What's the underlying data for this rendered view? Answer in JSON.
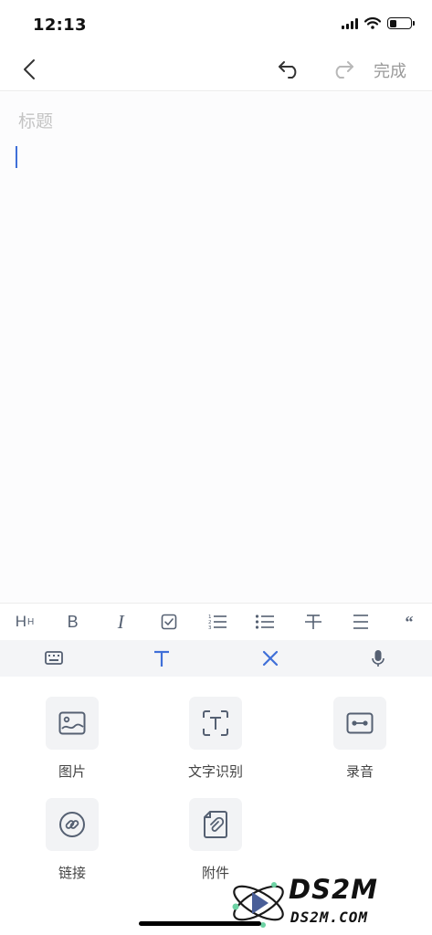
{
  "status_bar": {
    "time": "12:13",
    "battery_level": 0.35
  },
  "nav": {
    "back_icon": "chevron-left-icon",
    "undo_icon": "undo-icon",
    "redo_icon": "redo-icon",
    "done_label": "完成"
  },
  "editor": {
    "title_placeholder": "标题"
  },
  "format_bar": {
    "heading_label": "H",
    "heading_sub": "H",
    "bold_label": "B",
    "italic_label": "I",
    "checkbox_icon": "checkbox-icon",
    "ordered_list_icon": "ordered-list-icon",
    "bullet_list_icon": "bullet-list-icon",
    "strikethrough_icon": "strikethrough-icon",
    "align_icon": "align-icon",
    "quote_label": "“"
  },
  "mode_bar": {
    "items": [
      "keyboard-icon",
      "text-format-icon",
      "close-icon",
      "microphone-icon"
    ],
    "active_color": "#3f6fd8"
  },
  "tools": [
    {
      "label": "图片",
      "icon": "image-icon"
    },
    {
      "label": "文字识别",
      "icon": "text-recognition-icon"
    },
    {
      "label": "录音",
      "icon": "recording-icon"
    },
    {
      "label": "链接",
      "icon": "link-icon"
    },
    {
      "label": "附件",
      "icon": "attachment-icon"
    }
  ],
  "watermark": {
    "title": "DS2M",
    "url": "DS2M.COM"
  },
  "colors": {
    "accent": "#3f6fd8",
    "icon_gray": "#556072",
    "placeholder": "#c4c4c4"
  }
}
